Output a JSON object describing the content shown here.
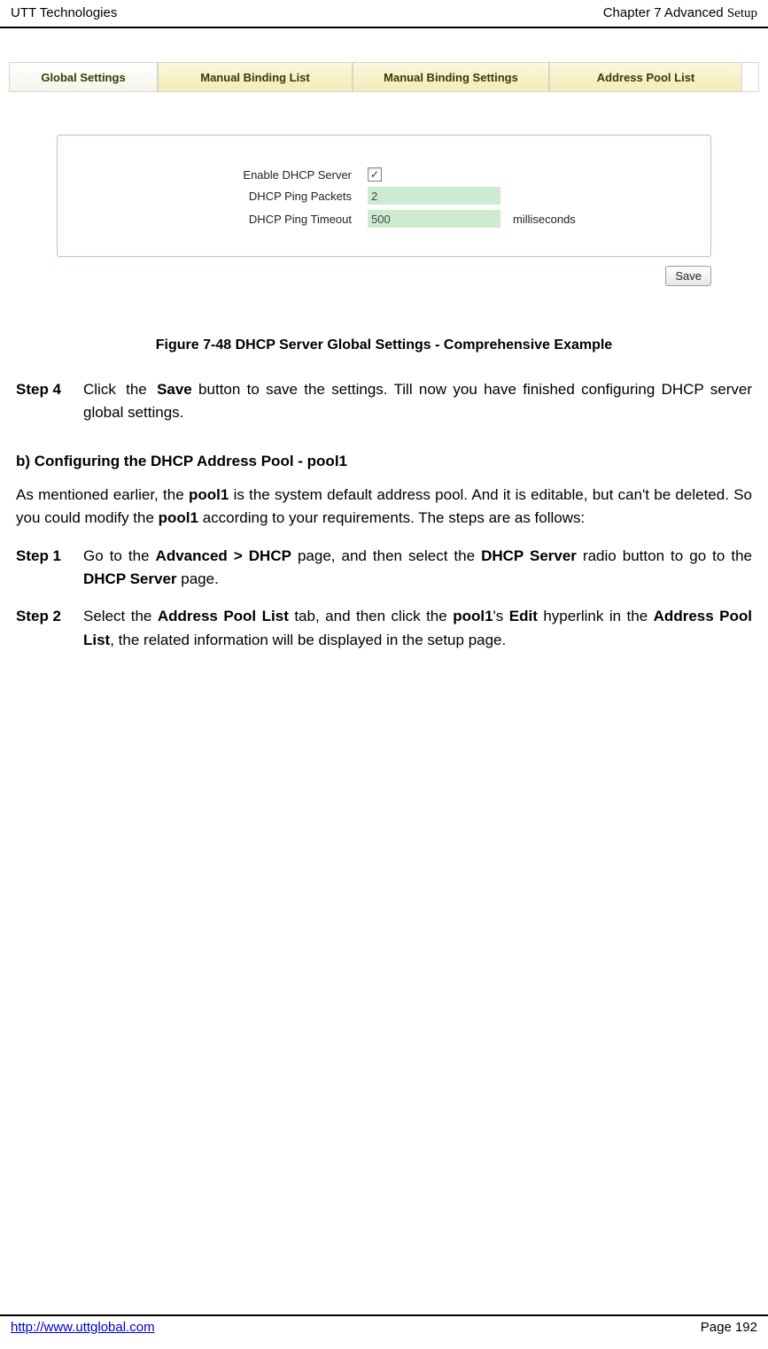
{
  "header": {
    "left": "UTT Technologies",
    "right_prefix": "Chapter 7 Advanced ",
    "right_suffix": "Setup"
  },
  "tabs": {
    "global": "Global Settings",
    "manual_list": "Manual Binding List",
    "manual_settings": "Manual Binding Settings",
    "address_pool": "Address Pool List"
  },
  "form": {
    "enable_label": "Enable DHCP Server",
    "enable_checked": "✓",
    "packets_label": "DHCP Ping Packets",
    "packets_value": "2",
    "timeout_label": "DHCP Ping Timeout",
    "timeout_value": "500",
    "timeout_unit": "milliseconds"
  },
  "buttons": {
    "save": "Save"
  },
  "figure_caption": "Figure 7-48 DHCP Server Global Settings - Comprehensive Example",
  "step4": {
    "label": "Step 4",
    "t1": "Click the ",
    "b1": "Save",
    "t2": " button to save the settings. Till now you have finished configuring DHCP server global settings."
  },
  "section_b": {
    "heading": "b)    Configuring the DHCP Address Pool - pool1",
    "p1a": "As mentioned earlier, the ",
    "p1b": "pool1",
    "p1c": " is the system default address pool. And it is editable, but can't be deleted. So you could modify the ",
    "p1d": "pool1",
    "p1e": " according to your requirements. The steps are as follows:"
  },
  "step1": {
    "label": "Step 1",
    "t1": "Go to the ",
    "b1": "Advanced > DHCP",
    "t2": " page, and then select the ",
    "b2": "DHCP Server",
    "t3": " radio button to go to the ",
    "b3": "DHCP Server",
    "t4": " page."
  },
  "step2": {
    "label": "Step 2",
    "t1": "Select the ",
    "b1": "Address Pool List",
    "t2": " tab, and then click the ",
    "b2": "pool1",
    "t3": "'s ",
    "b3": "Edit",
    "t4": " hyperlink in the ",
    "b4": "Address Pool List",
    "t5": ", the related information will be displayed in the setup page."
  },
  "footer": {
    "url": "http://www.uttglobal.com",
    "page_label": "Page 192"
  }
}
